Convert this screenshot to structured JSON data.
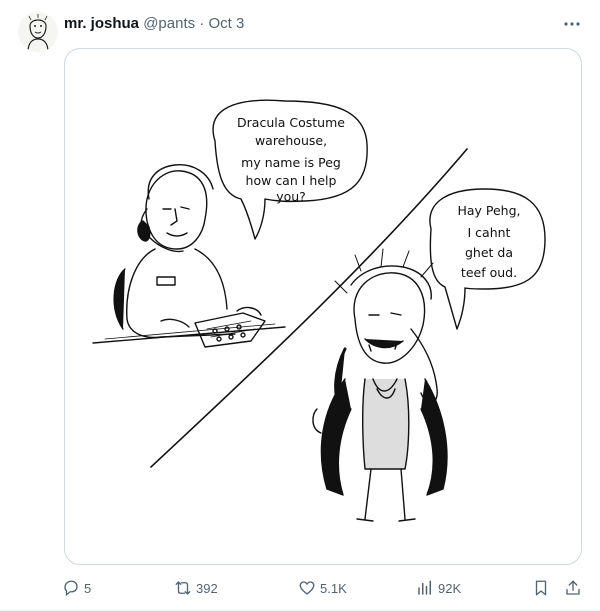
{
  "tweet": {
    "author_name": "mr. joshua",
    "author_handle": "@pants",
    "separator": "·",
    "date": "Oct 3"
  },
  "comic": {
    "bubble_left": [
      "Dracula Costume",
      "warehouse,",
      "my name is Peg",
      "how can I help",
      "you?"
    ],
    "bubble_right": [
      "Hay Pehg,",
      "I   cahnt",
      "ghet  da",
      "teef  oud."
    ]
  },
  "actions": {
    "replies": "5",
    "retweets": "392",
    "likes": "5.1K",
    "views": "92K"
  },
  "icons": {
    "more": "more-dots-icon",
    "reply": "reply-icon",
    "retweet": "retweet-icon",
    "like": "heart-icon",
    "views": "views-chart-icon",
    "bookmark": "bookmark-icon",
    "share": "share-icon"
  }
}
